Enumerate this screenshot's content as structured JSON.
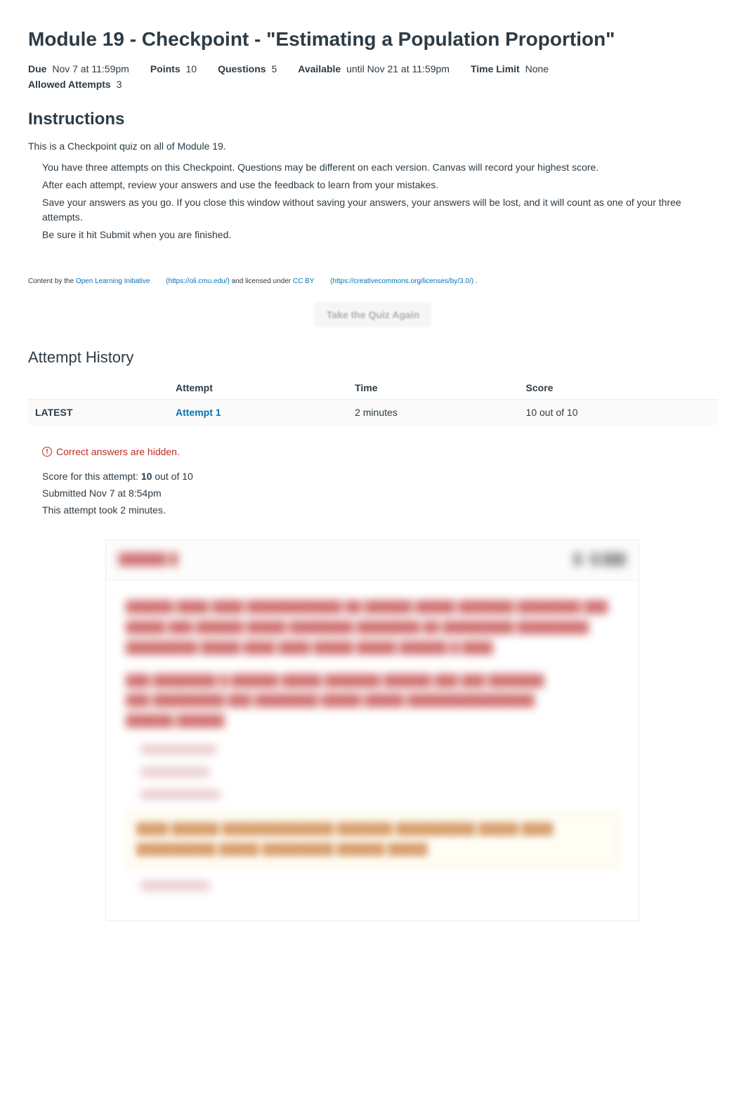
{
  "page_title": "Module 19 - Checkpoint - \"Estimating a Population Proportion\"",
  "meta": {
    "due_label": "Due",
    "due_value": "Nov 7 at 11:59pm",
    "points_label": "Points",
    "points_value": "10",
    "questions_label": "Questions",
    "questions_value": "5",
    "available_label": "Available",
    "available_value": "until Nov 21 at 11:59pm",
    "time_limit_label": "Time Limit",
    "time_limit_value": "None",
    "allowed_attempts_label": "Allowed Attempts",
    "allowed_attempts_value": "3"
  },
  "instructions_header": "Instructions",
  "instructions_intro": "This is a Checkpoint quiz on all of Module 19.",
  "instructions_list": [
    "You have three attempts on this Checkpoint. Questions may be different on each version. Canvas will record your highest score.",
    "After each attempt, review your answers and use the feedback to learn from your mistakes.",
    "Save your answers as you go. If you close this window without saving your answers, your answers will be lost, and it will count as one of your three attempts.",
    "Be sure it hit Submit when you are finished."
  ],
  "attribution": {
    "prefix": "Content by the ",
    "oli_text": "Open Learning Initiative",
    "oli_url_text": "(https://oli.cmu.edu/)",
    "mid": " and licensed under ",
    "cc_text": "CC BY",
    "cc_url_text": "(https://creativecommons.org/licenses/by/3.0/)",
    "suffix": " ."
  },
  "take_again": "Take the Quiz Again",
  "attempt_history_header": "Attempt History",
  "attempt_table": {
    "headers": {
      "blank": "",
      "attempt": "Attempt",
      "time": "Time",
      "score": "Score"
    },
    "rows": [
      {
        "latest": "LATEST",
        "attempt": "Attempt 1",
        "time": "2 minutes",
        "score": "10 out of 10"
      }
    ]
  },
  "hidden_answers": "Correct answers are hidden.",
  "score_block": {
    "line1_prefix": "Score for this attempt: ",
    "line1_score": "10",
    "line1_suffix": " out of 10",
    "line2": "Submitted Nov 7 at 8:54pm",
    "line3": "This attempt took 2 minutes."
  }
}
